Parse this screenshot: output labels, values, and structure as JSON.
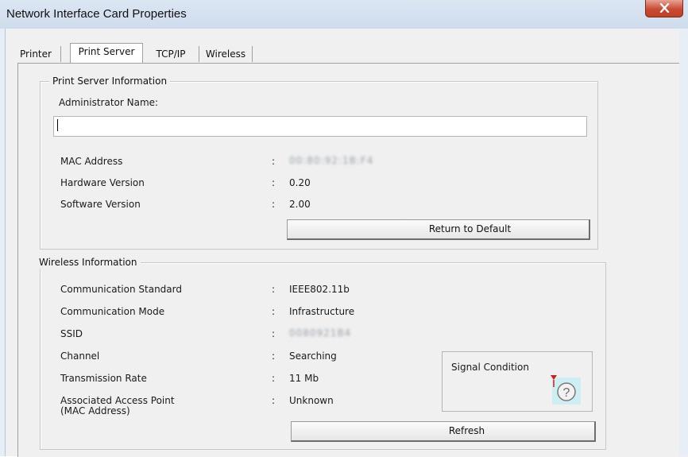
{
  "window": {
    "title": "Network Interface Card Properties",
    "close_icon": "close-icon"
  },
  "tabs": [
    {
      "label": "Printer",
      "active": false
    },
    {
      "label": "Print Server",
      "active": true
    },
    {
      "label": "TCP/IP",
      "active": false
    },
    {
      "label": "Wireless",
      "active": false
    }
  ],
  "print_server": {
    "legend": "Print Server Information",
    "admin_label": "Administrator Name:",
    "admin_value": "",
    "rows": [
      {
        "label": "MAC Address",
        "value": "00:80:92:1B:F4"
      },
      {
        "label": "Hardware Version",
        "value": "0.20"
      },
      {
        "label": "Software Version",
        "value": "2.00"
      }
    ],
    "colon": ":",
    "return_button": "Return to Default"
  },
  "wireless": {
    "legend": "Wireless Information",
    "rows": [
      {
        "label": "Communication Standard",
        "value": "IEEE802.11b"
      },
      {
        "label": "Communication Mode",
        "value": "Infrastructure"
      },
      {
        "label": "SSID",
        "value": "0080921B4"
      },
      {
        "label": "Channel",
        "value": "Searching"
      },
      {
        "label": "Transmission Rate",
        "value": "11 Mb"
      },
      {
        "label": "Associated Access Point",
        "label2": "(MAC Address)",
        "value": "Unknown"
      }
    ],
    "colon": ":",
    "signal_label": "Signal Condition",
    "signal_icon": "signal-unknown-icon",
    "refresh_button": "Refresh"
  },
  "colors": {
    "window_frame": "#e6eef7",
    "dialog_bg": "#f0f0f0",
    "close_red": "#c94a32"
  }
}
